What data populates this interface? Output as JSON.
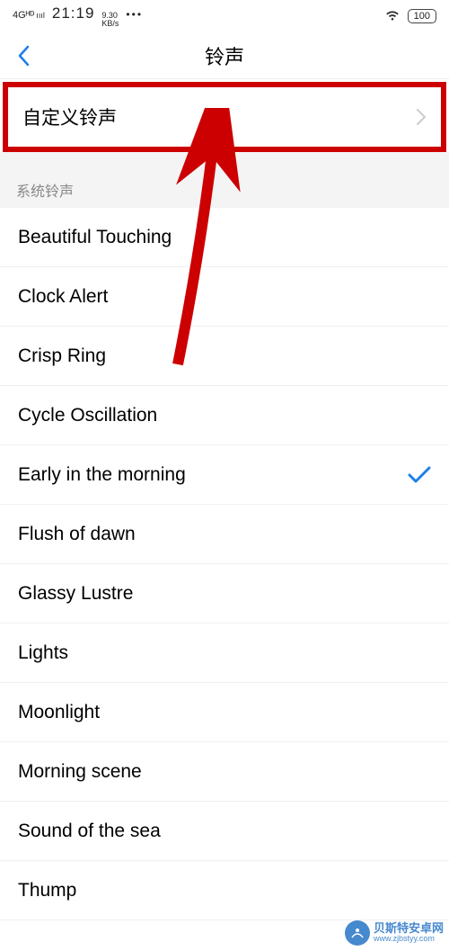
{
  "status": {
    "signal": "4Gᴴᴰ",
    "bars": "ıııl",
    "time": "21:19",
    "speed_top": "9.30",
    "speed_bot": "KB/s",
    "dots": "•••",
    "battery": "100"
  },
  "nav": {
    "title": "铃声"
  },
  "custom": {
    "label": "自定义铃声"
  },
  "section_header": "系统铃声",
  "items": [
    {
      "label": "Beautiful Touching",
      "selected": false
    },
    {
      "label": "Clock Alert",
      "selected": false
    },
    {
      "label": "Crisp Ring",
      "selected": false
    },
    {
      "label": "Cycle Oscillation",
      "selected": false
    },
    {
      "label": "Early in the morning",
      "selected": true
    },
    {
      "label": "Flush of dawn",
      "selected": false
    },
    {
      "label": "Glassy Lustre",
      "selected": false
    },
    {
      "label": "Lights",
      "selected": false
    },
    {
      "label": "Moonlight",
      "selected": false
    },
    {
      "label": "Morning scene",
      "selected": false
    },
    {
      "label": "Sound of the sea",
      "selected": false
    },
    {
      "label": "Thump",
      "selected": false
    }
  ],
  "watermark": {
    "line1": "贝斯特安卓网",
    "line2": "www.zjbstyy.com"
  }
}
